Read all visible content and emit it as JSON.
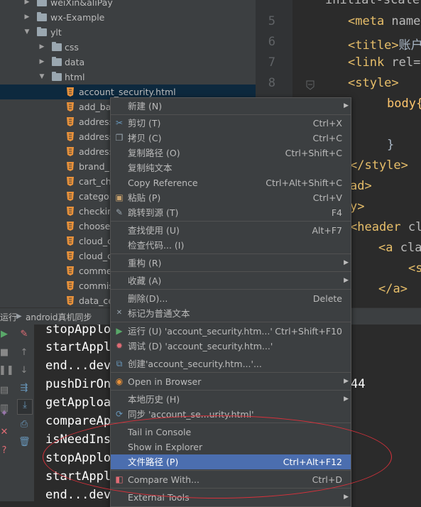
{
  "project_tree": {
    "items": [
      {
        "label": "weiXin&aliPay",
        "type": "folder",
        "expanded": false
      },
      {
        "label": "wx-Example",
        "type": "folder",
        "expanded": false
      },
      {
        "label": "ylt",
        "type": "folder",
        "expanded": true
      },
      {
        "label": "css",
        "type": "folder",
        "expanded": false
      },
      {
        "label": "data",
        "type": "folder",
        "expanded": false
      },
      {
        "label": "html",
        "type": "folder",
        "expanded": true
      },
      {
        "label": "account_security.html",
        "type": "html",
        "selected": true
      },
      {
        "label": "add_ba",
        "type": "html"
      },
      {
        "label": "address",
        "type": "html"
      },
      {
        "label": "address",
        "type": "html"
      },
      {
        "label": "address",
        "type": "html"
      },
      {
        "label": "brand_l",
        "type": "html"
      },
      {
        "label": "cart_che",
        "type": "html"
      },
      {
        "label": "categor",
        "type": "html"
      },
      {
        "label": "checkin",
        "type": "html"
      },
      {
        "label": "choose_",
        "type": "html"
      },
      {
        "label": "cloud_c",
        "type": "html"
      },
      {
        "label": "cloud_c",
        "type": "html"
      },
      {
        "label": "comme",
        "type": "html"
      },
      {
        "label": "commis",
        "type": "html"
      },
      {
        "label": "data_ce",
        "type": "html"
      }
    ]
  },
  "editor": {
    "line_numbers": [
      "5",
      "6",
      "7",
      "8"
    ],
    "lines": [
      {
        "text": "initial-scale"
      },
      {
        "tag": "<meta ",
        "rest": "name"
      },
      {
        "tag": "<title>",
        "rest": "账户"
      },
      {
        "tag": "<link ",
        "rest": "rel="
      },
      {
        "tag": "<style>",
        "rest": ""
      },
      {
        "tag": "",
        "rest": "body{"
      },
      {
        "tag": "",
        "rest": "}"
      },
      {
        "tag": "</style>",
        "rest": ""
      },
      {
        "tag": "ad>",
        "rest": ""
      },
      {
        "tag": "y>",
        "rest": ""
      },
      {
        "tag": "<header ",
        "rest": "cl"
      },
      {
        "tag": "<a ",
        "rest": "cla"
      },
      {
        "tag": "<s",
        "rest": ""
      },
      {
        "tag": "</a>",
        "rest": ""
      }
    ]
  },
  "run_panel": {
    "prefix": "运行",
    "config_name": "android真机同步",
    "console_lines": [
      "stopApplo",
      "startAppl",
      "end...dev",
      "pushDirOn",
      "getApploa",
      "compareAp",
      "isNeedIns",
      "stopApplo",
      "startAppl",
      "end...dev"
    ],
    "console_tail": "44"
  },
  "context_menu": {
    "items": [
      {
        "label": "新建 (N)",
        "shortcut": "",
        "submenu": true,
        "icon": ""
      },
      {
        "label": "剪切 (T)",
        "shortcut": "Ctrl+X",
        "icon": "scissors-icon"
      },
      {
        "label": "拷贝 (C)",
        "shortcut": "Ctrl+C",
        "icon": "copy-icon"
      },
      {
        "label": "复制路径 (O)",
        "shortcut": "Ctrl+Shift+C",
        "icon": ""
      },
      {
        "label": "复制纯文本",
        "shortcut": "",
        "icon": ""
      },
      {
        "label": "Copy Reference",
        "shortcut": "Ctrl+Alt+Shift+C",
        "icon": ""
      },
      {
        "label": "粘贴 (P)",
        "shortcut": "Ctrl+V",
        "icon": "paste-icon"
      },
      {
        "label": "跳转到源 (T)",
        "shortcut": "F4",
        "icon": "jump-to-source-icon"
      },
      {
        "label": "查找使用 (U)",
        "shortcut": "Alt+F7",
        "icon": ""
      },
      {
        "label": "检查代码... (I)",
        "shortcut": "",
        "icon": ""
      },
      {
        "label": "重构 (R)",
        "shortcut": "",
        "submenu": true,
        "icon": ""
      },
      {
        "label": "收藏 (A)",
        "shortcut": "",
        "submenu": true,
        "icon": ""
      },
      {
        "label": "删除(D)...",
        "shortcut": "Delete",
        "icon": ""
      },
      {
        "label": "标记为普通文本",
        "shortcut": "",
        "icon": "mark-plain-text-icon"
      },
      {
        "label": "运行 (U) 'account_security.htm...'",
        "shortcut": "Ctrl+Shift+F10",
        "icon": "run-icon"
      },
      {
        "label": "调试 (D) 'account_security.htm...'",
        "shortcut": "",
        "icon": "debug-icon"
      },
      {
        "label": "创建'account_security.htm...'...",
        "shortcut": "",
        "icon": "create-config-icon"
      },
      {
        "label": "Open in Browser",
        "shortcut": "",
        "submenu": true,
        "icon": "browser-icon"
      },
      {
        "label": "本地历史 (H)",
        "shortcut": "",
        "submenu": true,
        "icon": ""
      },
      {
        "label": "同步 'account_se...urity.html'",
        "shortcut": "",
        "icon": "sync-icon"
      },
      {
        "label": "Tail in Console",
        "shortcut": "",
        "icon": ""
      },
      {
        "label": "Show in Explorer",
        "shortcut": "",
        "icon": ""
      },
      {
        "label": "文件路径 (P)",
        "shortcut": "Ctrl+Alt+F12",
        "icon": "",
        "highlighted": true
      },
      {
        "label": "Compare With...",
        "shortcut": "Ctrl+D",
        "icon": "compare-icon"
      },
      {
        "label": "External Tools",
        "shortcut": "",
        "submenu": true,
        "icon": ""
      }
    ]
  },
  "colors": {
    "highlight": "#4b6eaf",
    "annotation_ellipse": "#d8313b",
    "tag": "#e8bf6a"
  }
}
